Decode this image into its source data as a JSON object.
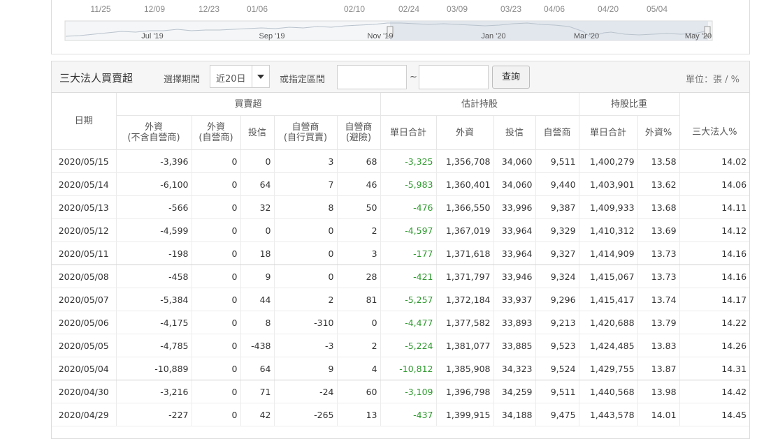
{
  "chart": {
    "top_dates": [
      "11/25",
      "12/09",
      "12/23",
      "01/06",
      "02/10",
      "02/24",
      "03/09",
      "03/23",
      "04/06",
      "04/20",
      "05/04"
    ],
    "navigator_labels": [
      "Jul '19",
      "Sep '19",
      "Nov '19",
      "Jan '20",
      "Mar '20",
      "May '20"
    ]
  },
  "toolbar": {
    "title": "三大法人買賣超",
    "period_label": "選擇期間",
    "period_value": "近20日",
    "range_label": "或指定區間",
    "start_value": "",
    "tilde": "~",
    "end_value": "",
    "query_label": "查詢",
    "unit": "單位：張 / %"
  },
  "table": {
    "date_header": "日期",
    "groups": {
      "buysell": "買賣超",
      "holding": "估計持股",
      "ratio": "持股比重"
    },
    "columns": {
      "foreign_ex": [
        "外資",
        "(不含自營商)"
      ],
      "foreign_dealer": [
        "外資",
        "(自營商)"
      ],
      "trust": "投信",
      "dealer_self": [
        "自營商",
        "(自行買賣)"
      ],
      "dealer_hedge": [
        "自營商",
        "(避險)"
      ],
      "daily_total": "單日合計",
      "hold_foreign": "外資",
      "hold_trust": "投信",
      "hold_dealer": "自營商",
      "hold_total": "單日合計",
      "foreign_pct": "外資%",
      "total_pct": "三大法人%"
    },
    "rows": [
      {
        "date": "2020/05/15",
        "c": [
          "-3,396",
          "0",
          "0",
          "3",
          "68",
          "-3,325",
          "1,356,708",
          "34,060",
          "9,511",
          "1,400,279",
          "13.58",
          "14.02"
        ]
      },
      {
        "date": "2020/05/14",
        "c": [
          "-6,100",
          "0",
          "64",
          "7",
          "46",
          "-5,983",
          "1,360,401",
          "34,060",
          "9,440",
          "1,403,901",
          "13.62",
          "14.06"
        ]
      },
      {
        "date": "2020/05/13",
        "c": [
          "-566",
          "0",
          "32",
          "8",
          "50",
          "-476",
          "1,366,550",
          "33,996",
          "9,387",
          "1,409,933",
          "13.68",
          "14.11"
        ]
      },
      {
        "date": "2020/05/12",
        "c": [
          "-4,599",
          "0",
          "0",
          "0",
          "2",
          "-4,597",
          "1,367,019",
          "33,964",
          "9,329",
          "1,410,312",
          "13.69",
          "14.12"
        ]
      },
      {
        "date": "2020/05/11",
        "c": [
          "-198",
          "0",
          "18",
          "0",
          "3",
          "-177",
          "1,371,618",
          "33,964",
          "9,327",
          "1,414,909",
          "13.73",
          "14.16"
        ]
      },
      {
        "date": "2020/05/08",
        "c": [
          "-458",
          "0",
          "9",
          "0",
          "28",
          "-421",
          "1,371,797",
          "33,946",
          "9,324",
          "1,415,067",
          "13.73",
          "14.16"
        ]
      },
      {
        "date": "2020/05/07",
        "c": [
          "-5,384",
          "0",
          "44",
          "2",
          "81",
          "-5,257",
          "1,372,184",
          "33,937",
          "9,296",
          "1,415,417",
          "13.74",
          "14.17"
        ]
      },
      {
        "date": "2020/05/06",
        "c": [
          "-4,175",
          "0",
          "8",
          "-310",
          "0",
          "-4,477",
          "1,377,582",
          "33,893",
          "9,213",
          "1,420,688",
          "13.79",
          "14.22"
        ]
      },
      {
        "date": "2020/05/05",
        "c": [
          "-4,785",
          "0",
          "-438",
          "-3",
          "2",
          "-5,224",
          "1,381,077",
          "33,885",
          "9,523",
          "1,424,485",
          "13.83",
          "14.26"
        ]
      },
      {
        "date": "2020/05/04",
        "c": [
          "-10,889",
          "0",
          "64",
          "9",
          "4",
          "-10,812",
          "1,385,908",
          "34,323",
          "9,524",
          "1,429,755",
          "13.87",
          "14.31"
        ]
      },
      {
        "date": "2020/04/30",
        "c": [
          "-3,216",
          "0",
          "71",
          "-24",
          "60",
          "-3,109",
          "1,396,798",
          "34,259",
          "9,511",
          "1,440,568",
          "13.98",
          "14.42"
        ]
      },
      {
        "date": "2020/04/29",
        "c": [
          "-227",
          "0",
          "42",
          "-265",
          "13",
          "-437",
          "1,399,915",
          "34,188",
          "9,475",
          "1,443,578",
          "14.01",
          "14.45"
        ]
      }
    ]
  },
  "colors": {
    "positive_negative_total": "#2e9a2e",
    "header_bg": "#f6f6f6"
  }
}
